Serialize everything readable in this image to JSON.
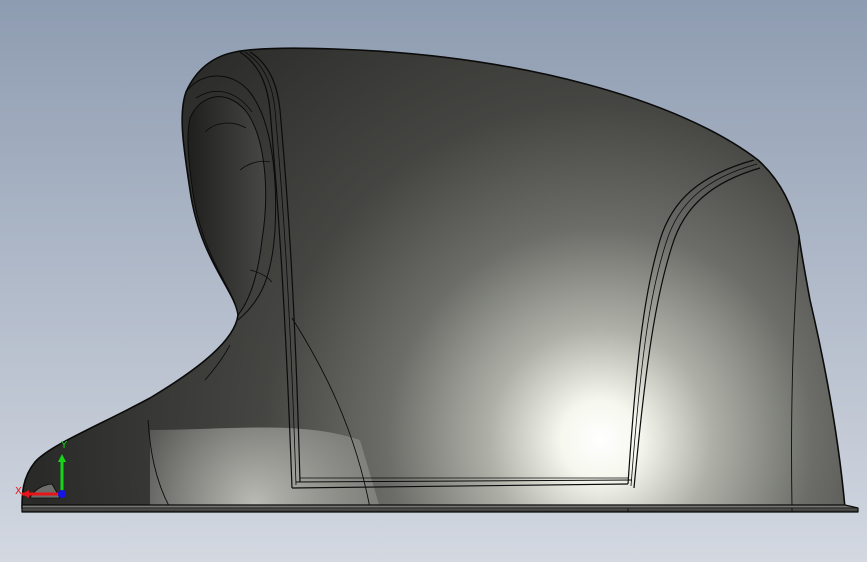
{
  "viewport": {
    "background_top": "#8e9cb1",
    "background_bottom": "#d3d8e1",
    "model": {
      "name": "ergonomic-mouse-shell",
      "body_color": "#3c3c3a",
      "highlight_color": "#ffffff",
      "edge_color": "#0a0a0a"
    }
  },
  "triad": {
    "x_label": "X",
    "y_label": "Y",
    "x_color": "#e8141a",
    "y_color": "#18d418",
    "z_color": "#1414e6"
  }
}
